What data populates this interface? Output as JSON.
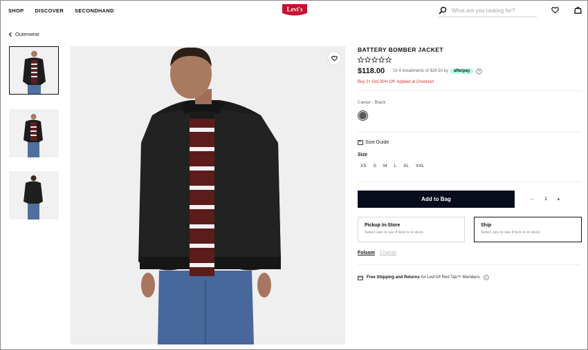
{
  "header": {
    "nav": [
      "SHOP",
      "DISCOVER",
      "SECONDHAND"
    ],
    "logo_text": "Levi's",
    "search_placeholder": "What are you looking for?"
  },
  "breadcrumb": {
    "label": "Outerwear"
  },
  "product": {
    "title": "BATTERY BOMBER JACKET",
    "price": "$118.00",
    "installments": "Or 4 installments of $29.50 by",
    "afterpay_label": "afterpay",
    "promo": "Buy 2+ Get 30% Off: Applied at Checkout",
    "color_label": "Caviar - Black",
    "size_guide": "Size Guide",
    "size_title": "Size",
    "sizes": [
      "XS",
      "S",
      "M",
      "L",
      "XL",
      "XXL"
    ],
    "add_to_bag": "Add to Bag",
    "qty_minus": "–",
    "qty": "1",
    "qty_plus": "+",
    "pickup_title": "Pickup In-Store",
    "pickup_sub": "Select size to see if item is in stock",
    "ship_title": "Ship",
    "ship_sub": "Select size to see if item is in stock",
    "store_name": "Folsom",
    "store_change": "Change",
    "shipping_bold": "Free Shipping and Returns",
    "shipping_rest": "for Levi's® Red Tab™ Members"
  },
  "colors": {
    "brand_red": "#c41230",
    "button_navy": "#070c1c",
    "promo_red": "#d0342c",
    "afterpay_mint": "#b2fce4"
  }
}
